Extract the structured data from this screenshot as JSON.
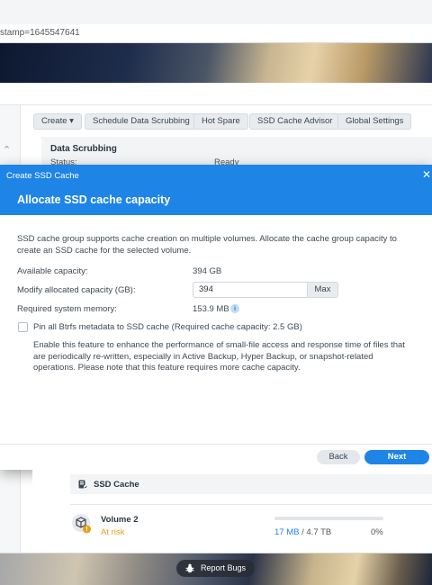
{
  "browser": {
    "url_fragment": "stamp=1645547641"
  },
  "toolbar": {
    "create_label": "Create",
    "schedule_label": "Schedule Data Scrubbing",
    "hotspare_label": "Hot Spare",
    "advisor_label": "SSD Cache Advisor",
    "settings_label": "Global Settings"
  },
  "scrubbing": {
    "title": "Data Scrubbing",
    "status_label": "Status:",
    "status_value": "Ready"
  },
  "dialog": {
    "window_title": "Create SSD Cache",
    "heading": "Allocate SSD cache capacity",
    "description": "SSD cache group supports cache creation on multiple volumes. Allocate the cache group capacity to create an SSD cache for the selected volume.",
    "available_label": "Available capacity:",
    "available_value": "394 GB",
    "modify_label": "Modify allocated capacity (GB):",
    "modify_value": "394",
    "max_label": "Max",
    "memory_label": "Required system memory:",
    "memory_value": "153.9 MB",
    "pin_label": "Pin all Btrfs metadata to SSD cache (Required cache capacity: 2.5 GB)",
    "pin_description": "Enable this feature to enhance the performance of small-file access and response time of files that are periodically re-written, especially in Active Backup, Hyper Backup, or snapshot-related operations. Please note that this feature requires more cache capacity.",
    "back_label": "Back",
    "next_label": "Next"
  },
  "ssd_cache": {
    "title": "SSD Cache",
    "volume": {
      "name": "Volume 2",
      "status": "At risk",
      "used": "17 MB",
      "separator": " / ",
      "total": "4.7 TB",
      "percent": "0%",
      "usage_fraction": 0
    }
  },
  "footer": {
    "report_label": "Report Bugs"
  },
  "colors": {
    "accent": "#1e84e6",
    "warning": "#e5a019"
  },
  "icons": {
    "info": "info-icon",
    "ssd": "ssd-cache-icon",
    "volume": "volume-cube-icon",
    "bug": "bug-icon",
    "close": "close-icon",
    "chevron": "chevron-up-icon"
  }
}
